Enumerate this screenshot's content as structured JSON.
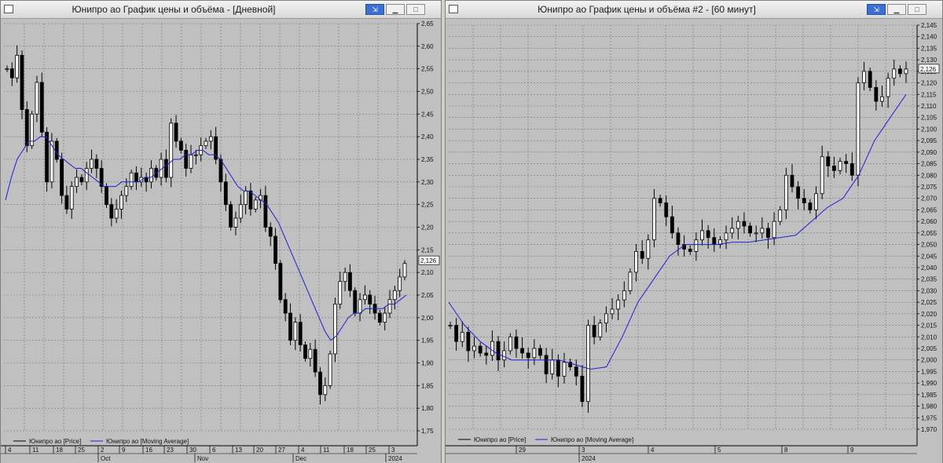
{
  "left": {
    "title": "Юнипро ао График цены и объёма - [Дневной]",
    "yticks": [
      "2,65",
      "2,60",
      "2,55",
      "2,50",
      "2,45",
      "2,40",
      "2,35",
      "2,30",
      "2,25",
      "2,20",
      "2,15",
      "2,10",
      "2,05",
      "2,00",
      "1,95",
      "1,90",
      "1,85",
      "1,80",
      "1,75"
    ],
    "current": "2,126",
    "legend": [
      "Юнипро ао [Price]",
      "Юнипро ао [Moving Average]"
    ],
    "xdays": [
      "4",
      "11",
      "18",
      "25",
      "2",
      "9",
      "16",
      "23",
      "30",
      "6",
      "13",
      "20",
      "27",
      "4",
      "11",
      "18",
      "25",
      "3"
    ],
    "xmonths": [
      "Oct",
      "Nov",
      "Dec",
      "2024"
    ]
  },
  "right": {
    "title": "Юнипро ао График цены и объёма #2 - [60 минут]",
    "yticks": [
      "2,145",
      "2,140",
      "2,135",
      "2,130",
      "2,125",
      "2,120",
      "2,115",
      "2,110",
      "2,105",
      "2,100",
      "2,095",
      "2,090",
      "2,085",
      "2,080",
      "2,075",
      "2,070",
      "2,065",
      "2,060",
      "2,055",
      "2,050",
      "2,045",
      "2,040",
      "2,035",
      "2,030",
      "2,025",
      "2,020",
      "2,015",
      "2,010",
      "2,005",
      "2,000",
      "1,995",
      "1,990",
      "1,985",
      "1,980",
      "1,975",
      "1,970"
    ],
    "current": "2,126",
    "legend": [
      "Юнипро ао [Price]",
      "Юнипро ао [Moving Average]"
    ],
    "xdays": [
      "29",
      "3",
      "4",
      "5",
      "8",
      "9"
    ],
    "xyear": "2024"
  },
  "chart_data": [
    {
      "type": "candlestick",
      "title": "Юнипро ао График цены и объёма - [Дневной]",
      "ylim": [
        1.75,
        2.65
      ],
      "series": [
        {
          "name": "Юнипро ао [Price]",
          "close": [
            2.55,
            2.53,
            2.58,
            2.46,
            2.38,
            2.45,
            2.52,
            2.41,
            2.3,
            2.39,
            2.35,
            2.27,
            2.24,
            2.29,
            2.31,
            2.3,
            2.33,
            2.35,
            2.33,
            2.29,
            2.25,
            2.22,
            2.24,
            2.27,
            2.29,
            2.32,
            2.3,
            2.31,
            2.3,
            2.33,
            2.31,
            2.35,
            2.31,
            2.43,
            2.39,
            2.37,
            2.33,
            2.36,
            2.36,
            2.38,
            2.39,
            2.4,
            2.35,
            2.3,
            2.25,
            2.2,
            2.22,
            2.25,
            2.28,
            2.24,
            2.26,
            2.27,
            2.2,
            2.18,
            2.12,
            2.04,
            2.01,
            1.95,
            1.99,
            1.94,
            1.91,
            1.93,
            1.88,
            1.83,
            1.85,
            1.92,
            2.03,
            2.08,
            2.1,
            2.06,
            2.01,
            2.04,
            2.05,
            2.03,
            2.01,
            1.99,
            2.01,
            2.04,
            2.06,
            2.09,
            2.12
          ]
        },
        {
          "name": "Юнипро ао [Moving Average]",
          "values": [
            2.26,
            2.31,
            2.35,
            2.37,
            2.39,
            2.39,
            2.4,
            2.4,
            2.38,
            2.36,
            2.35,
            2.34,
            2.33,
            2.33,
            2.32,
            2.31,
            2.3,
            2.29,
            2.29,
            2.29,
            2.3,
            2.3,
            2.3,
            2.3,
            2.31,
            2.31,
            2.32,
            2.33,
            2.34,
            2.35,
            2.35,
            2.36,
            2.36,
            2.37,
            2.37,
            2.36,
            2.36,
            2.35,
            2.33,
            2.31,
            2.29,
            2.28,
            2.28,
            2.27,
            2.26,
            2.25,
            2.23,
            2.21,
            2.18,
            2.15,
            2.12,
            2.09,
            2.06,
            2.03,
            2.0,
            1.97,
            1.95,
            1.96,
            1.98,
            2.0,
            2.01,
            2.01,
            2.02,
            2.02,
            2.02,
            2.02,
            2.03,
            2.03,
            2.04,
            2.05
          ]
        }
      ]
    },
    {
      "type": "candlestick",
      "title": "Юнипро ао График цены и объёма #2 - [60 минут]",
      "ylim": [
        1.97,
        2.145
      ],
      "series": [
        {
          "name": "Юнипро ао [Price]",
          "close": [
            2.015,
            2.008,
            2.012,
            2.004,
            2.006,
            2.003,
            2.002,
            2.008,
            2.0,
            2.004,
            2.01,
            2.005,
            2.003,
            2.001,
            2.005,
            2.002,
            1.994,
            2.0,
            1.993,
            1.999,
            1.997,
            1.993,
            1.982,
            2.015,
            2.01,
            2.016,
            2.02,
            2.022,
            2.026,
            2.03,
            2.038,
            2.047,
            2.044,
            2.052,
            2.07,
            2.068,
            2.062,
            2.055,
            2.05,
            2.048,
            2.047,
            2.052,
            2.056,
            2.053,
            2.05,
            2.052,
            2.055,
            2.057,
            2.06,
            2.058,
            2.055,
            2.055,
            2.057,
            2.053,
            2.06,
            2.065,
            2.08,
            2.075,
            2.07,
            2.068,
            2.065,
            2.072,
            2.088,
            2.084,
            2.082,
            2.086,
            2.085,
            2.08,
            2.12,
            2.125,
            2.118,
            2.112,
            2.114,
            2.122,
            2.126,
            2.124,
            2.126
          ]
        },
        {
          "name": "Юнипро ао [Moving Average]",
          "values": [
            2.025,
            2.015,
            2.008,
            2.003,
            2.0,
            2.0,
            2.0,
            2.0,
            1.998,
            1.996,
            1.997,
            2.01,
            2.025,
            2.035,
            2.045,
            2.05,
            2.05,
            2.05,
            2.051,
            2.051,
            2.052,
            2.053,
            2.054,
            2.06,
            2.066,
            2.07,
            2.08,
            2.095,
            2.105,
            2.115
          ]
        }
      ]
    }
  ]
}
